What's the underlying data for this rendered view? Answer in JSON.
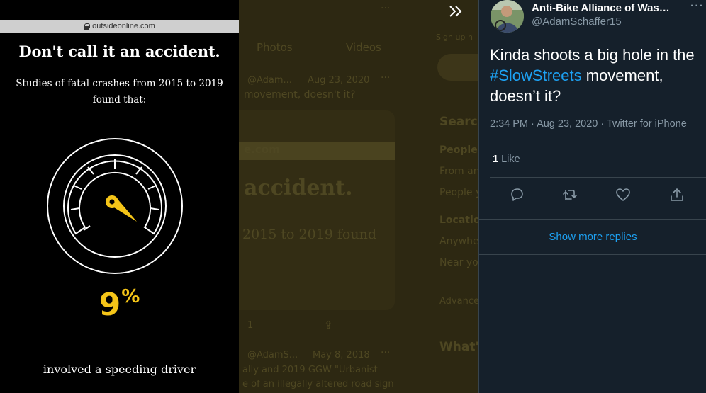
{
  "image_view": {
    "url": "outsideonline.com",
    "headline": "Don't call it an accident.",
    "subtext": "Studies of fatal crashes from 2015 to 2019 found that:",
    "stat_value": "9",
    "stat_unit": "%",
    "caption": "involved a speeding driver",
    "accent_color": "#f5c518"
  },
  "background": {
    "tab_photos": "Photos",
    "tab_videos": "Videos",
    "tweet1_handle": "@Adam...",
    "tweet1_date": "Aug 23, 2020",
    "tweet1_text": "movement, doesn't it?",
    "card_url": "e.com",
    "card_headline": "accident.",
    "card_subtext": "2015 to 2019 found",
    "tweet2_handle": "@AdamS...",
    "tweet2_date": "May 8, 2018",
    "tweet2_line1": "ally and 2019 GGW \"Urbanist",
    "tweet2_line2": "e of an illegally altered road sign",
    "side_search": "Search",
    "side_people": "People",
    "side_from": "From an",
    "side_people2": "People y",
    "side_location": "Location",
    "side_anywhere": "Anywhe",
    "side_near": "Near yo",
    "side_advanced": "Advance",
    "side_whats": "What'",
    "side_sign": "Sign up n"
  },
  "tweet": {
    "display_name": "Anti-Bike Alliance of Wash...",
    "handle": "@AdamSchaffer15",
    "text_before": "Kinda shoots a big hole in the ",
    "hashtag": "#SlowStreets",
    "text_after": " movement, doesn’t it?",
    "timestamp": "2:34 PM · Aug 23, 2020 · Twitter for iPhone",
    "like_count": "1",
    "like_label": "Like",
    "show_more_replies": "Show more replies",
    "more_icon_label": "···",
    "link_color": "#1da1f2"
  }
}
